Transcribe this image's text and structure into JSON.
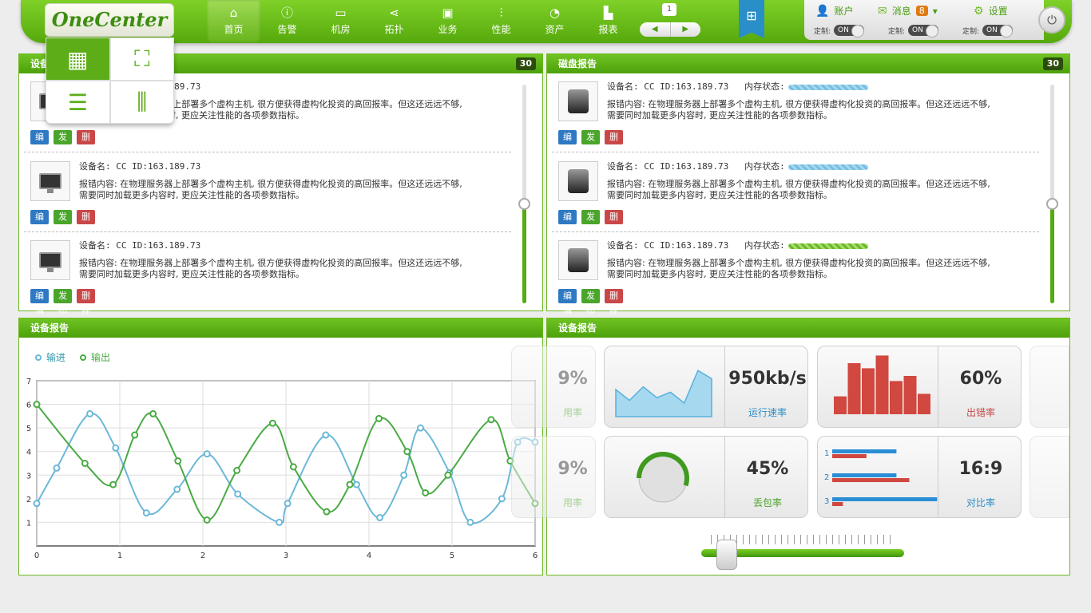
{
  "brand": {
    "logo": "OneCenter"
  },
  "nav": [
    {
      "label": "首页",
      "icon": "home-icon",
      "glyph": "⌂"
    },
    {
      "label": "告警",
      "icon": "info-icon",
      "glyph": "ⓘ"
    },
    {
      "label": "机房",
      "icon": "monitor-icon",
      "glyph": "▭"
    },
    {
      "label": "拓扑",
      "icon": "share-icon",
      "glyph": "⋖"
    },
    {
      "label": "业务",
      "icon": "briefcase-icon",
      "glyph": "▣"
    },
    {
      "label": "性能",
      "icon": "sliders-icon",
      "glyph": "⫶"
    },
    {
      "label": "资产",
      "icon": "pie-icon",
      "glyph": "◔"
    },
    {
      "label": "报表",
      "icon": "bar-chart-icon",
      "glyph": "▙"
    }
  ],
  "pager": {
    "page": "1",
    "prev": "◀",
    "next": "▶"
  },
  "user": {
    "account": "账户",
    "messages": "消息",
    "message_count": "8",
    "settings": "设置",
    "custom": "定制:",
    "toggle": "ON"
  },
  "panels": {
    "device_report_title": "设备报告",
    "device_count": "30",
    "disk_report_title": "磁盘报告",
    "disk_count": "30",
    "chart_title": "设备报告",
    "stats_title": "设备报告"
  },
  "device_items": [
    {
      "name": "设备名: CC  ID:163.189.73",
      "desc1": "报错内容: 在物理服务器上部署多个虚构主机, 很方便获得虚构化投资的高回报率。但这还远远不够,",
      "desc2": "需要同时加载更多内容时, 更应关注性能的各项参数指标。"
    },
    {
      "name": "设备名: CC  ID:163.189.73",
      "desc1": "报错内容: 在物理服务器上部署多个虚构主机, 很方便获得虚构化投资的高回报率。但这还远远不够,",
      "desc2": "需要同时加载更多内容时, 更应关注性能的各项参数指标。"
    },
    {
      "name": "设备名: CC  ID:163.189.73",
      "desc1": "报错内容: 在物理服务器上部署多个虚构主机, 很方便获得虚构化投资的高回报率。但这还远远不够,",
      "desc2": "需要同时加载更多内容时, 更应关注性能的各项参数指标。"
    }
  ],
  "disk_items": [
    {
      "name": "设备名: CC  ID:163.189.73",
      "mem_label": "内存状态:",
      "desc1": "报错内容: 在物理服务器上部署多个虚构主机, 很方便获得虚构化投资的高回报率。但这还远远不够,",
      "desc2": "需要同时加载更多内容时, 更应关注性能的各项参数指标。"
    },
    {
      "name": "设备名: CC  ID:163.189.73",
      "mem_label": "内存状态:",
      "desc1": "报错内容: 在物理服务器上部署多个虚构主机, 很方便获得虚构化投资的高回报率。但这还远远不够,",
      "desc2": "需要同时加载更多内容时, 更应关注性能的各项参数指标。"
    },
    {
      "name": "设备名: CC  ID:163.189.73",
      "mem_label": "内存状态:",
      "desc1": "报错内容: 在物理服务器上部署多个虚构主机, 很方便获得虚构化投资的高回报率。但这还远远不够,",
      "desc2": "需要同时加载更多内容时, 更应关注性能的各项参数指标。"
    }
  ],
  "buttons": {
    "edit": "编辑",
    "publish": "发布",
    "delete": "删除"
  },
  "stats": [
    {
      "value": "950kb/s",
      "label": "运行速率",
      "label_color": "#2a8ec8"
    },
    {
      "value": "60%",
      "label": "出错率",
      "label_color": "#c94747"
    },
    {
      "value": "45%",
      "label": "丢包率",
      "label_color": "#4aa52b"
    },
    {
      "value": "16:9",
      "label": "对比率",
      "label_color": "#2a8ec8"
    }
  ],
  "ghost_stats": [
    {
      "value": "9%",
      "label": "用率"
    },
    {
      "value": "9%",
      "label": "用率"
    }
  ],
  "bars_chart": {
    "values": [
      0.35,
      1.0,
      0.9,
      1.15,
      0.65,
      0.75,
      0.4
    ]
  },
  "hbar_chart": {
    "rows": [
      {
        "n": "1",
        "a": 0.6,
        "b": 0.32
      },
      {
        "n": "2",
        "a": 0.6,
        "b": 0.72
      },
      {
        "n": "3",
        "a": 0.98,
        "b": 0.1
      }
    ]
  },
  "donut": {
    "fraction": 0.55
  },
  "area": {
    "values": [
      0.5,
      0.3,
      0.55,
      0.35,
      0.45,
      0.25,
      0.85,
      0.7
    ]
  },
  "chart_data": {
    "type": "line",
    "xlim": [
      0,
      6
    ],
    "ylim": [
      0,
      7
    ],
    "x_ticks": [
      0,
      1,
      2,
      3,
      4,
      5,
      6
    ],
    "y_ticks": [
      1,
      2,
      3,
      4,
      5,
      6,
      7
    ],
    "grid": true,
    "legend_position": "top-left",
    "series": [
      {
        "name": "输进",
        "color": "#6cb8d8",
        "x": [
          0,
          0.24,
          0.64,
          0.95,
          1.32,
          1.69,
          2.05,
          2.42,
          2.92,
          3.02,
          3.48,
          3.85,
          4.13,
          4.42,
          4.62,
          4.97,
          5.22,
          5.6,
          5.79,
          6.0
        ],
        "y": [
          1.8,
          3.3,
          5.6,
          4.15,
          1.4,
          2.4,
          3.9,
          2.2,
          1.0,
          1.8,
          4.7,
          2.6,
          1.2,
          3.0,
          5.0,
          3.1,
          1.0,
          2.0,
          4.4,
          4.4
        ]
      },
      {
        "name": "输出",
        "color": "#4aaa44",
        "x": [
          0,
          0.58,
          0.92,
          1.18,
          1.4,
          1.7,
          2.05,
          2.41,
          2.84,
          3.09,
          3.49,
          3.77,
          4.12,
          4.46,
          4.68,
          4.95,
          5.47,
          5.7,
          6.0
        ],
        "y": [
          6.0,
          3.5,
          2.6,
          4.7,
          5.6,
          3.6,
          1.1,
          3.2,
          5.2,
          3.35,
          1.45,
          2.6,
          5.4,
          4.0,
          2.25,
          3.0,
          5.35,
          3.6,
          1.8
        ]
      }
    ]
  }
}
